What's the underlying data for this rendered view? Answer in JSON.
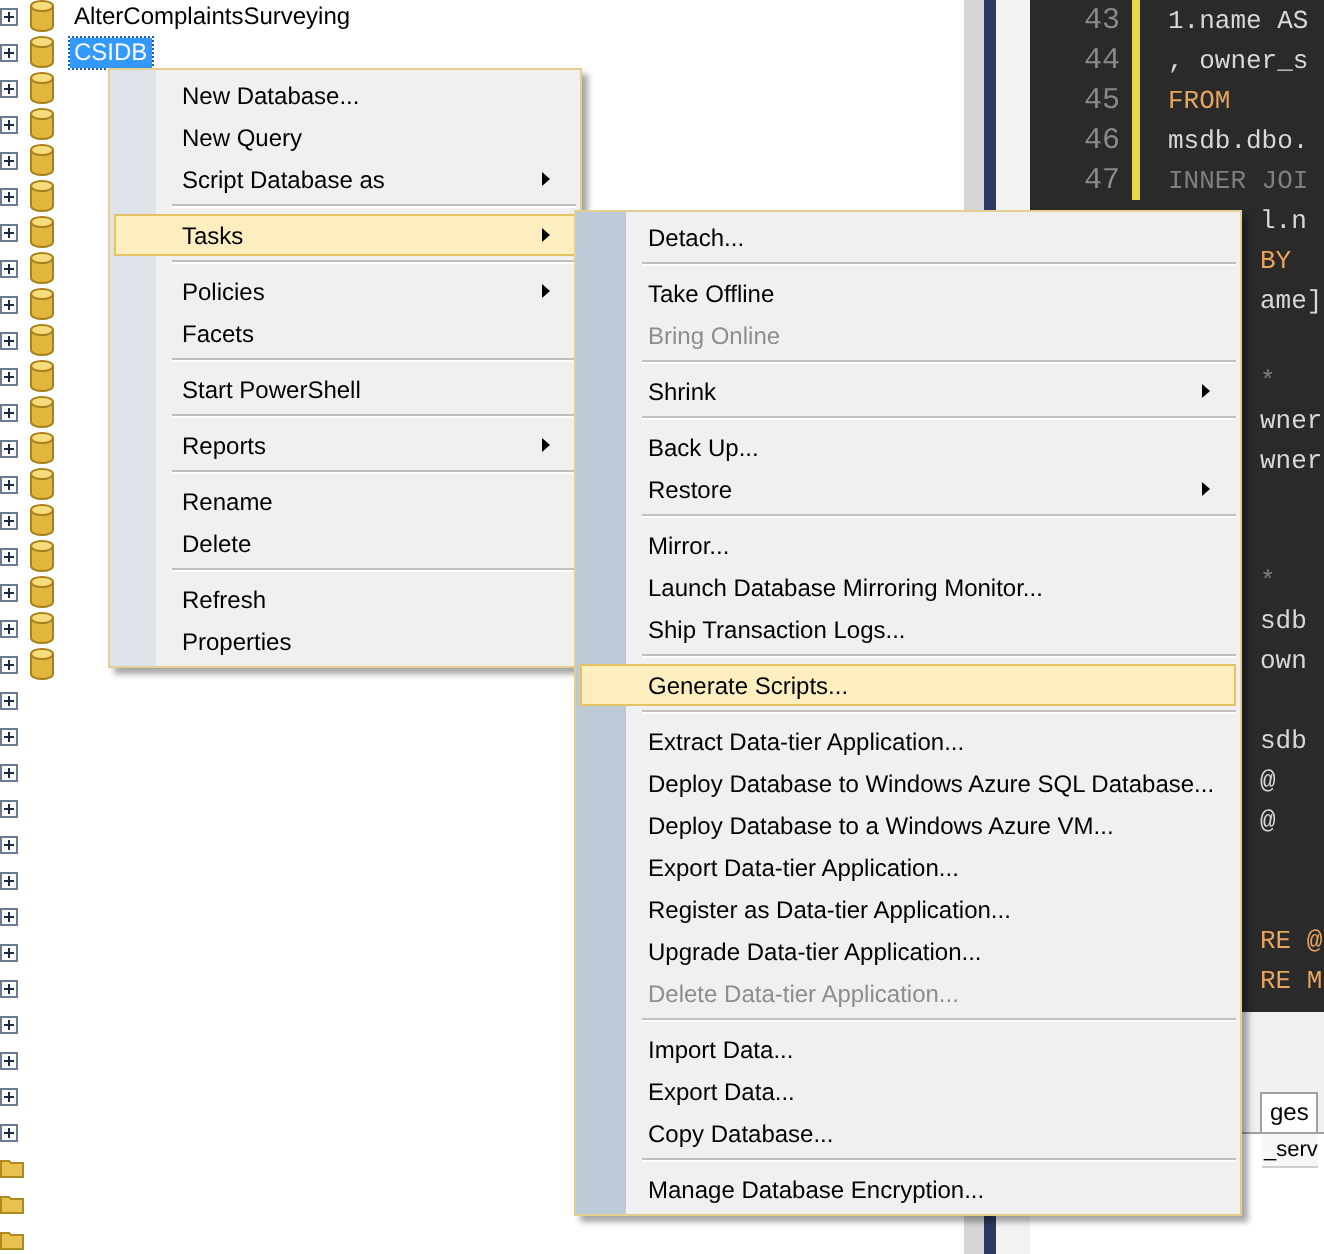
{
  "tree": {
    "rows": [
      {
        "kind": "database",
        "label": "AlterComplaintsSurveying",
        "selected": false,
        "expanded": false
      },
      {
        "kind": "database",
        "label": "CSIDB",
        "selected": true,
        "expanded": false
      },
      {
        "kind": "database",
        "selected": false,
        "expanded": false
      },
      {
        "kind": "database",
        "selected": false,
        "expanded": false
      },
      {
        "kind": "database",
        "selected": false,
        "expanded": false
      },
      {
        "kind": "database",
        "selected": false,
        "expanded": false
      },
      {
        "kind": "database",
        "selected": false,
        "expanded": false
      },
      {
        "kind": "database",
        "selected": false,
        "expanded": false
      },
      {
        "kind": "database",
        "selected": false,
        "expanded": false
      },
      {
        "kind": "database",
        "selected": false,
        "expanded": false
      },
      {
        "kind": "database",
        "selected": false,
        "expanded": false
      },
      {
        "kind": "database",
        "selected": false,
        "expanded": false
      },
      {
        "kind": "database",
        "selected": false,
        "expanded": false
      },
      {
        "kind": "database",
        "selected": false,
        "expanded": false
      },
      {
        "kind": "database",
        "selected": false,
        "expanded": false
      },
      {
        "kind": "database",
        "selected": false,
        "expanded": false
      },
      {
        "kind": "database",
        "selected": false,
        "expanded": false
      },
      {
        "kind": "database",
        "selected": false,
        "expanded": false
      },
      {
        "kind": "database",
        "selected": false,
        "expanded": false
      },
      {
        "kind": "node",
        "selected": false,
        "expanded": false
      },
      {
        "kind": "node",
        "selected": false,
        "expanded": false
      },
      {
        "kind": "node",
        "selected": false,
        "expanded": false
      },
      {
        "kind": "node",
        "selected": false,
        "expanded": false
      },
      {
        "kind": "node",
        "selected": false,
        "expanded": false
      },
      {
        "kind": "node",
        "selected": false,
        "expanded": false
      },
      {
        "kind": "node",
        "selected": false,
        "expanded": false
      },
      {
        "kind": "node",
        "selected": false,
        "expanded": false
      },
      {
        "kind": "node",
        "selected": false,
        "expanded": false
      },
      {
        "kind": "node",
        "selected": false,
        "expanded": false
      },
      {
        "kind": "node",
        "selected": false,
        "expanded": false
      },
      {
        "kind": "node",
        "selected": false,
        "expanded": false
      },
      {
        "kind": "node",
        "selected": false,
        "expanded": false
      },
      {
        "kind": "folder",
        "selected": false
      },
      {
        "kind": "folder",
        "selected": false
      },
      {
        "kind": "folder",
        "selected": false
      }
    ]
  },
  "editor": {
    "lines": [
      {
        "number": "43",
        "text": "1.name AS",
        "kind": "plain"
      },
      {
        "number": "44",
        "text": ", owner_s",
        "kind": "plain"
      },
      {
        "number": "45",
        "text": "FROM",
        "kind": "keyword"
      },
      {
        "number": "46",
        "text": "msdb.dbo.",
        "kind": "plain"
      },
      {
        "number": "47",
        "text": "INNER JOI",
        "kind": "dim"
      },
      {
        "text": "l.n",
        "kind": "plain"
      },
      {
        "text": "BY",
        "kind": "keyword"
      },
      {
        "text": "ame]",
        "kind": "plain"
      },
      {
        "kind": "blank"
      },
      {
        "text": "*",
        "kind": "dim"
      },
      {
        "text": "wner",
        "kind": "plain"
      },
      {
        "text": "wner",
        "kind": "plain"
      },
      {
        "kind": "blank"
      },
      {
        "kind": "blank"
      },
      {
        "text": "*",
        "kind": "dim"
      },
      {
        "text": "sdb",
        "kind": "plain"
      },
      {
        "text": "own",
        "kind": "plain"
      },
      {
        "kind": "blank"
      },
      {
        "text": "sdb",
        "kind": "plain"
      },
      {
        "text": "@",
        "kind": "plain"
      },
      {
        "text": "@",
        "kind": "plain"
      },
      {
        "kind": "blank"
      },
      {
        "kind": "blank"
      },
      {
        "text": "RE @",
        "kind": "keyword"
      },
      {
        "text": "RE M",
        "kind": "keyword"
      }
    ]
  },
  "results": {
    "tabs": [
      {
        "label": "ges",
        "selected": true
      }
    ],
    "column_header": "_serv"
  },
  "context_menu": {
    "groups": [
      [
        {
          "label": "New Database...",
          "submenu": false,
          "selected": false,
          "disabled": false
        },
        {
          "label": "New Query",
          "submenu": false,
          "selected": false,
          "disabled": false
        },
        {
          "label": "Script Database as",
          "submenu": true,
          "selected": false,
          "disabled": false
        }
      ],
      [
        {
          "label": "Tasks",
          "submenu": true,
          "selected": true,
          "disabled": false
        }
      ],
      [
        {
          "label": "Policies",
          "submenu": true,
          "selected": false,
          "disabled": false
        },
        {
          "label": "Facets",
          "submenu": false,
          "selected": false,
          "disabled": false
        }
      ],
      [
        {
          "label": "Start PowerShell",
          "submenu": false,
          "selected": false,
          "disabled": false
        }
      ],
      [
        {
          "label": "Reports",
          "submenu": true,
          "selected": false,
          "disabled": false
        }
      ],
      [
        {
          "label": "Rename",
          "submenu": false,
          "selected": false,
          "disabled": false
        },
        {
          "label": "Delete",
          "submenu": false,
          "selected": false,
          "disabled": false
        }
      ],
      [
        {
          "label": "Refresh",
          "submenu": false,
          "selected": false,
          "disabled": false
        },
        {
          "label": "Properties",
          "submenu": false,
          "selected": false,
          "disabled": false
        }
      ]
    ]
  },
  "tasks_submenu": {
    "groups": [
      [
        {
          "label": "Detach...",
          "submenu": false,
          "selected": false,
          "disabled": false
        }
      ],
      [
        {
          "label": "Take Offline",
          "submenu": false,
          "selected": false,
          "disabled": false
        },
        {
          "label": "Bring Online",
          "submenu": false,
          "selected": false,
          "disabled": true
        }
      ],
      [
        {
          "label": "Shrink",
          "submenu": true,
          "selected": false,
          "disabled": false
        }
      ],
      [
        {
          "label": "Back Up...",
          "submenu": false,
          "selected": false,
          "disabled": false
        },
        {
          "label": "Restore",
          "submenu": true,
          "selected": false,
          "disabled": false
        }
      ],
      [
        {
          "label": "Mirror...",
          "submenu": false,
          "selected": false,
          "disabled": false
        },
        {
          "label": "Launch Database Mirroring Monitor...",
          "submenu": false,
          "selected": false,
          "disabled": false
        },
        {
          "label": "Ship Transaction Logs...",
          "submenu": false,
          "selected": false,
          "disabled": false
        }
      ],
      [
        {
          "label": "Generate Scripts...",
          "submenu": false,
          "selected": true,
          "disabled": false
        }
      ],
      [
        {
          "label": "Extract Data-tier Application...",
          "submenu": false,
          "selected": false,
          "disabled": false
        },
        {
          "label": "Deploy Database to Windows Azure SQL Database...",
          "submenu": false,
          "selected": false,
          "disabled": false
        },
        {
          "label": "Deploy Database to a Windows Azure VM...",
          "submenu": false,
          "selected": false,
          "disabled": false
        },
        {
          "label": "Export Data-tier Application...",
          "submenu": false,
          "selected": false,
          "disabled": false
        },
        {
          "label": "Register as Data-tier Application...",
          "submenu": false,
          "selected": false,
          "disabled": false
        },
        {
          "label": "Upgrade Data-tier Application...",
          "submenu": false,
          "selected": false,
          "disabled": false
        },
        {
          "label": "Delete Data-tier Application...",
          "submenu": false,
          "selected": false,
          "disabled": true
        }
      ],
      [
        {
          "label": "Import Data...",
          "submenu": false,
          "selected": false,
          "disabled": false
        },
        {
          "label": "Export Data...",
          "submenu": false,
          "selected": false,
          "disabled": false
        },
        {
          "label": "Copy Database...",
          "submenu": false,
          "selected": false,
          "disabled": false
        }
      ],
      [
        {
          "label": "Manage Database Encryption...",
          "submenu": false,
          "selected": false,
          "disabled": false
        }
      ]
    ]
  }
}
